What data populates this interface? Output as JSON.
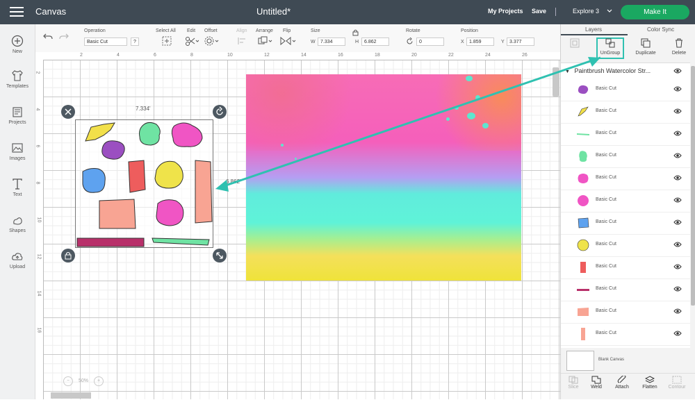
{
  "header": {
    "app_title": "Canvas",
    "doc_title": "Untitled*",
    "my_projects": "My Projects",
    "save": "Save",
    "machine": "Explore 3",
    "make_it": "Make It"
  },
  "left_nav": [
    {
      "label": "New",
      "icon": "plus-circle-icon"
    },
    {
      "label": "Templates",
      "icon": "shirt-icon"
    },
    {
      "label": "Projects",
      "icon": "projects-icon"
    },
    {
      "label": "Images",
      "icon": "image-icon"
    },
    {
      "label": "Text",
      "icon": "text-icon"
    },
    {
      "label": "Shapes",
      "icon": "shapes-icon"
    },
    {
      "label": "Upload",
      "icon": "cloud-upload-icon"
    }
  ],
  "toolbar": {
    "operation_label": "Operation",
    "operation_value": "Basic Cut",
    "help": "?",
    "select_all": "Select All",
    "edit": "Edit",
    "offset": "Offset",
    "align": "Align",
    "arrange": "Arrange",
    "flip": "Flip",
    "size": "Size",
    "w": "W",
    "w_value": "7.334",
    "h": "H",
    "h_value": "6.862",
    "rotate": "Rotate",
    "rotate_value": "0",
    "position": "Position",
    "x": "X",
    "x_value": "1.859",
    "y": "Y",
    "y_value": "3.377"
  },
  "canvas": {
    "ruler_top": [
      "2",
      "4",
      "6",
      "8",
      "10",
      "12",
      "14",
      "16",
      "18",
      "20",
      "22",
      "24",
      "26"
    ],
    "ruler_left": [
      "2",
      "4",
      "6",
      "8",
      "10",
      "12",
      "14",
      "16"
    ],
    "selection_width": "7.334'",
    "selection_height": "6.862'",
    "zoom_value": "50%",
    "zoom_minus": "−",
    "zoom_plus": "+"
  },
  "panel": {
    "tab_layers": "Layers",
    "tab_color_sync": "Color Sync",
    "group_action": "Group",
    "ungroup": "UnGroup",
    "duplicate": "Duplicate",
    "delete": "Delete",
    "group_name": "Paintbrush Watercolor Str...",
    "layers": [
      {
        "label": "Basic Cut",
        "color": "#9b4fc1"
      },
      {
        "label": "Basic Cut",
        "color": "#f2e04a"
      },
      {
        "label": "Basic Cut",
        "color": "#6fe3a3"
      },
      {
        "label": "Basic Cut",
        "color": "#6fe3a3"
      },
      {
        "label": "Basic Cut",
        "color": "#f055c4"
      },
      {
        "label": "Basic Cut",
        "color": "#f055c4"
      },
      {
        "label": "Basic Cut",
        "color": "#5ea2ef"
      },
      {
        "label": "Basic Cut",
        "color": "#efe34a"
      },
      {
        "label": "Basic Cut",
        "color": "#ee5d5d"
      },
      {
        "label": "Basic Cut",
        "color": "#b8306a"
      },
      {
        "label": "Basic Cut",
        "color": "#f8a493"
      },
      {
        "label": "Basic Cut",
        "color": "#f8a493"
      }
    ],
    "blank_canvas": "Blank Canvas",
    "tools": [
      {
        "label": "Slice",
        "enabled": false
      },
      {
        "label": "Weld",
        "enabled": true
      },
      {
        "label": "Attach",
        "enabled": true
      },
      {
        "label": "Flatten",
        "enabled": true
      },
      {
        "label": "Contour",
        "enabled": false
      }
    ]
  },
  "colors": {
    "header": "#3f4a54",
    "make_it": "#1aa861",
    "annotation": "#2fc1b1"
  }
}
